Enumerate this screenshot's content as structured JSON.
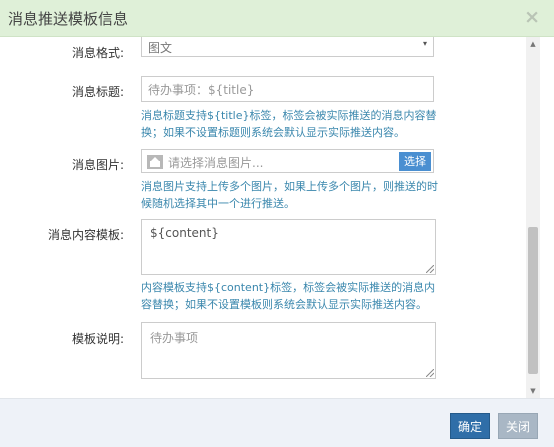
{
  "dialog": {
    "title": "消息推送模板信息",
    "close_icon": "×"
  },
  "form": {
    "format": {
      "label": "消息格式:",
      "value": "图文"
    },
    "title_field": {
      "label": "消息标题:",
      "placeholder": "待办事项：${title}",
      "help": "消息标题支持${title}标签，标签会被实际推送的消息内容替换；如果不设置标题则系统会默认显示实际推送内容。"
    },
    "image_field": {
      "label": "消息图片:",
      "placeholder": "请选择消息图片...",
      "button_label": "选择",
      "help": "消息图片支持上传多个图片，如果上传多个图片，则推送的时候随机选择其中一个进行推送。"
    },
    "content_template": {
      "label": "消息内容模板:",
      "value": "${content}",
      "help": "内容模板支持${content}标签，标签会被实际推送的消息内容替换；如果不设置模板则系统会默认显示实际推送内容。"
    },
    "description": {
      "label": "模板说明:",
      "placeholder": "待办事项"
    }
  },
  "footer": {
    "confirm_label": "确定",
    "close_label": "关闭"
  },
  "colors": {
    "header_bg": "#dff0d8",
    "help_text": "#3a87ad",
    "primary_button": "#2f6ea8",
    "disabled_button": "#a9b7c5"
  }
}
